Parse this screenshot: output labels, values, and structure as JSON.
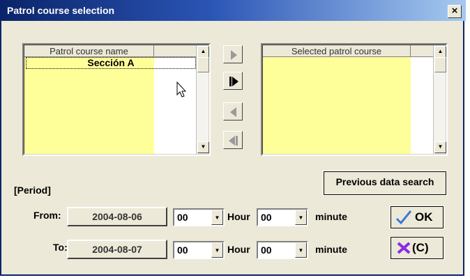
{
  "window": {
    "title": "Patrol course selection",
    "close_glyph": "×"
  },
  "left_list": {
    "header": "Patrol course name",
    "items": [
      "Sección A"
    ]
  },
  "right_list": {
    "header": "Selected patrol course",
    "items": []
  },
  "move_buttons": [
    {
      "icon": "arrow-right-icon",
      "enabled": false
    },
    {
      "icon": "arrow-right-all-icon",
      "enabled": true
    },
    {
      "icon": "arrow-left-icon",
      "enabled": false
    },
    {
      "icon": "arrow-left-all-icon",
      "enabled": false
    }
  ],
  "previous_search_label": "Previous data search",
  "period_label": "[Period]",
  "from": {
    "label": "From:",
    "date": "2004-08-06",
    "hour": "00",
    "hour_label": "Hour",
    "minute": "00",
    "minute_label": "minute"
  },
  "to": {
    "label": "To:",
    "date": "2004-08-07",
    "hour": "00",
    "hour_label": "Hour",
    "minute": "00",
    "minute_label": "minute"
  },
  "ok_label": "OK",
  "cancel_label": "(C)",
  "colors": {
    "list_bg": "#ffff99",
    "title_start": "#0a246a",
    "title_end": "#a6caf0",
    "ok_check": "#3b7ad9",
    "cancel_x": "#8a2be2"
  }
}
